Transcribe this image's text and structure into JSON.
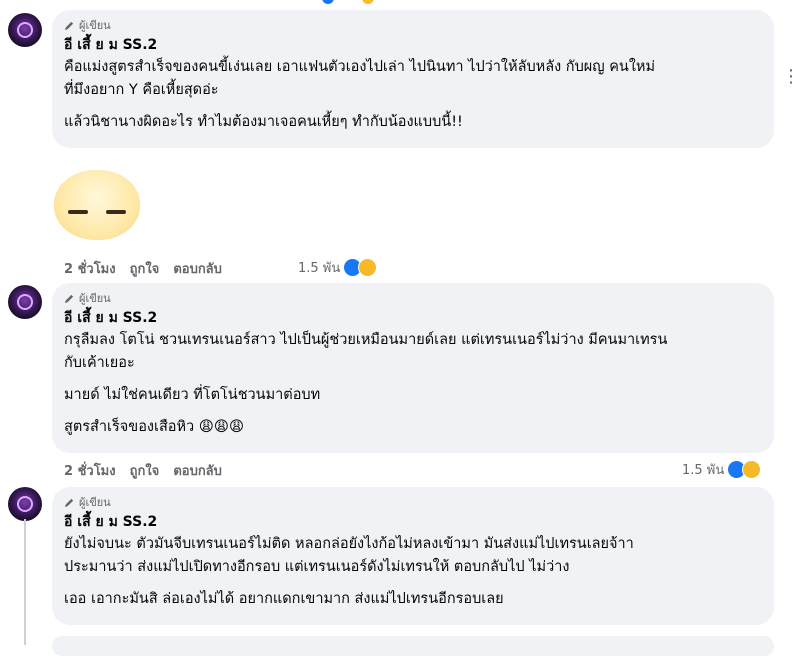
{
  "badge_label": "ผู้เขียน",
  "comments": [
    {
      "author": "อี เสี้ ย ม SS.2",
      "lines": [
        "คือแม่งสูตรสำเร็จของคนขี้เง่นเลย เอาแฟนตัวเองไปเล่า ไปนินทา ไปว่าให้ลับหลัง กับผญ คนใหม่",
        "ที่มึงอยาก Y คือเหี้ยสุดอ่ะ",
        "แล้วนิชานางผิดอะไร ทำไมต้องมาเจอคนเหี้ยๆ ทำกับน้องแบบนี้!!"
      ],
      "time": "2 ชั่วโมง",
      "like": "ถูกใจ",
      "reply": "ตอบกลับ",
      "reactions": "1.5 พัน"
    },
    {
      "author": "อี เสี้ ย ม SS.2",
      "lines": [
        "กรุลืมลง โตโน่ ชวนเทรนเนอร์สาว ไปเป็นผู้ช่วยเหมือนมายด์เลย แต่เทรนเนอร์ไม่ว่าง มีคนมาเทรน",
        "กับเค้าเยอะ",
        "มายด์ ไม่ใช่คนเดียว ที่โตโน่ชวนมาต่อบท",
        "สูตรสำเร็จของเสือหิว 😩😩😩"
      ],
      "time": "2 ชั่วโมง",
      "like": "ถูกใจ",
      "reply": "ตอบกลับ",
      "reactions": "1.5 พัน"
    },
    {
      "author": "อี เสี้ ย ม SS.2",
      "lines": [
        "ยังไม่จบนะ ตัวมันจีบเทรนเนอร์ไม่ติด หลอกล่อยังไงก้อไม่หลงเข้ามา มันส่งแม่ไปเทรนเลยจ้าา",
        "ประมานว่า ส่งแม่ไปเปิดทางอีกรอบ แต่เทรนเนอร์ดังไม่เทรนให้ ตอบกลับไป ไม่ว่าง",
        "เออ เอากะมันสิ ล่อเองไม่ได้ อยากแดกเขามาก ส่งแม่ไปเทรนอีกรอบเลย"
      ]
    }
  ],
  "colors": {
    "bubble": "#f0f2f5",
    "meta": "#65676b",
    "like": "#1877f2",
    "haha": "#f7b928"
  }
}
